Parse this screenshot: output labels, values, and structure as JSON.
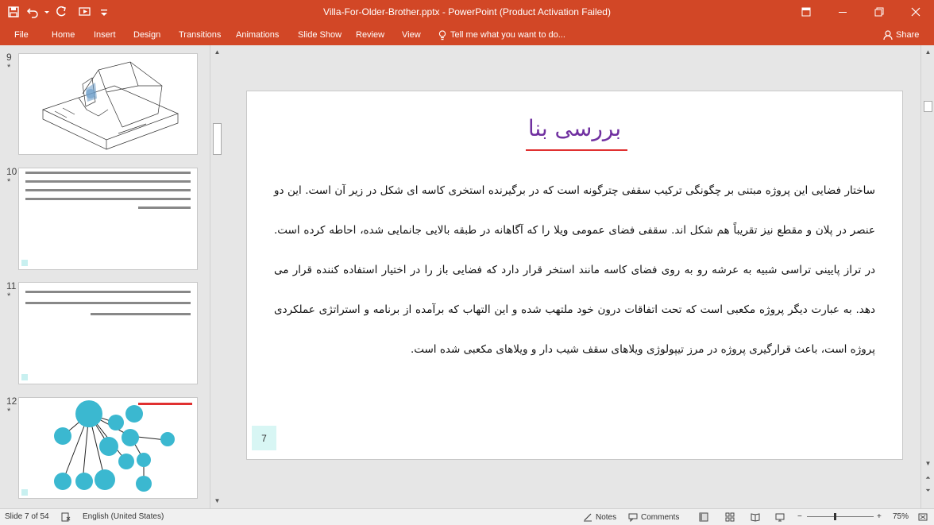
{
  "titlebar": {
    "title": "Villa-For-Older-Brother.pptx - PowerPoint (Product Activation Failed)"
  },
  "ribbon": {
    "tabs": [
      "File",
      "Home",
      "Insert",
      "Design",
      "Transitions",
      "Animations",
      "Slide Show",
      "Review",
      "View"
    ],
    "tell_me": "Tell me what you want to do...",
    "share": "Share"
  },
  "thumbnails": [
    {
      "number": "9",
      "star": "*"
    },
    {
      "number": "10",
      "star": "*"
    },
    {
      "number": "11",
      "star": "*"
    },
    {
      "number": "12",
      "star": "*"
    }
  ],
  "slide": {
    "title": "بررسی بنا",
    "body": "ساختار فضایی این پروژه مبتنی بر چگونگی ترکیب سقفی چترگونه است که در برگیرنده استخری کاسه ای شکل در زیر آن است. این دو عنصر در پلان و مقطع نیز تقریباً هم شکل اند. سقفی فضای عمومی ویلا را که آگاهانه در طبقه بالایی جانمایی شده، احاطه کرده است. در تراز پایینی تراسی شبیه به عرشه رو به روی فضای کاسه مانند استخر قرار دارد که فضایی باز را در اختیار استفاده کننده قرار می دهد. به عبارت دیگر پروژه مکعبی است که تحت اتفاقات درون خود ملتهب شده و این التهاب که برآمده از برنامه و استراتژی عملکردی پروژه است، باعث قرارگیری پروژه در مرز تیپولوژی ویلاهای سقف شیب دار و ویلاهای مکعبی شده است.",
    "page_number": "7"
  },
  "statusbar": {
    "slide_info": "Slide 7 of 54",
    "language": "English (United States)",
    "notes": "Notes",
    "comments": "Comments",
    "zoom": "75%"
  },
  "colors": {
    "accent": "#d24726",
    "title_color": "#7030a0",
    "underline": "#e03030",
    "page_box": "#d8f6f4",
    "bubble": "#3bb8d0"
  }
}
